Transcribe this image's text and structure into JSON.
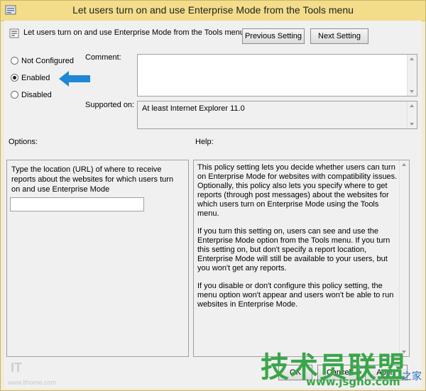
{
  "window": {
    "title": "Let users turn on and use Enterprise Mode from the Tools menu"
  },
  "header": {
    "setting_name": "Let users turn on and use Enterprise Mode from the Tools menu",
    "previous_label": "Previous Setting",
    "next_label": "Next Setting"
  },
  "state": {
    "options": [
      {
        "label": "Not Configured",
        "selected": false
      },
      {
        "label": "Enabled",
        "selected": true
      },
      {
        "label": "Disabled",
        "selected": false
      }
    ]
  },
  "comment": {
    "label": "Comment:",
    "value": ""
  },
  "supported": {
    "label": "Supported on:",
    "value": "At least Internet Explorer 11.0"
  },
  "options_panel": {
    "label": "Options:",
    "description": "Type the location (URL) of where to receive reports about the websites for which users turn on and use Enterprise Mode",
    "url_value": ""
  },
  "help_panel": {
    "label": "Help:",
    "paragraphs": [
      "This policy setting lets you decide whether users can turn on Enterprise Mode for websites with compatibility issues. Optionally, this policy also lets you specify where to get reports (through post messages) about the websites for which users turn on Enterprise Mode using the Tools menu.",
      "If you turn this setting on, users can see and use the Enterprise Mode option from the Tools menu. If you turn this setting on, but don't specify a report location, Enterprise Mode will still be available to your users, but you won't get any reports.",
      "If you disable or don't configure this policy setting, the menu option won't appear and users won't be able to run websites in Enterprise Mode."
    ]
  },
  "footer": {
    "ok_label": "OK",
    "cancel_label": "Cancel",
    "apply_label": "Apply"
  },
  "watermark": {
    "site_cn": "技术员联盟",
    "site_url": "www.jsgho.com",
    "side_zh": "之家",
    "left_url": "www.ithome.com",
    "left_logo": "IT"
  },
  "colors": {
    "arrow": "#1e88d6",
    "titlebar": "#f4dd8a",
    "watermark_green": "#3aa64a"
  }
}
